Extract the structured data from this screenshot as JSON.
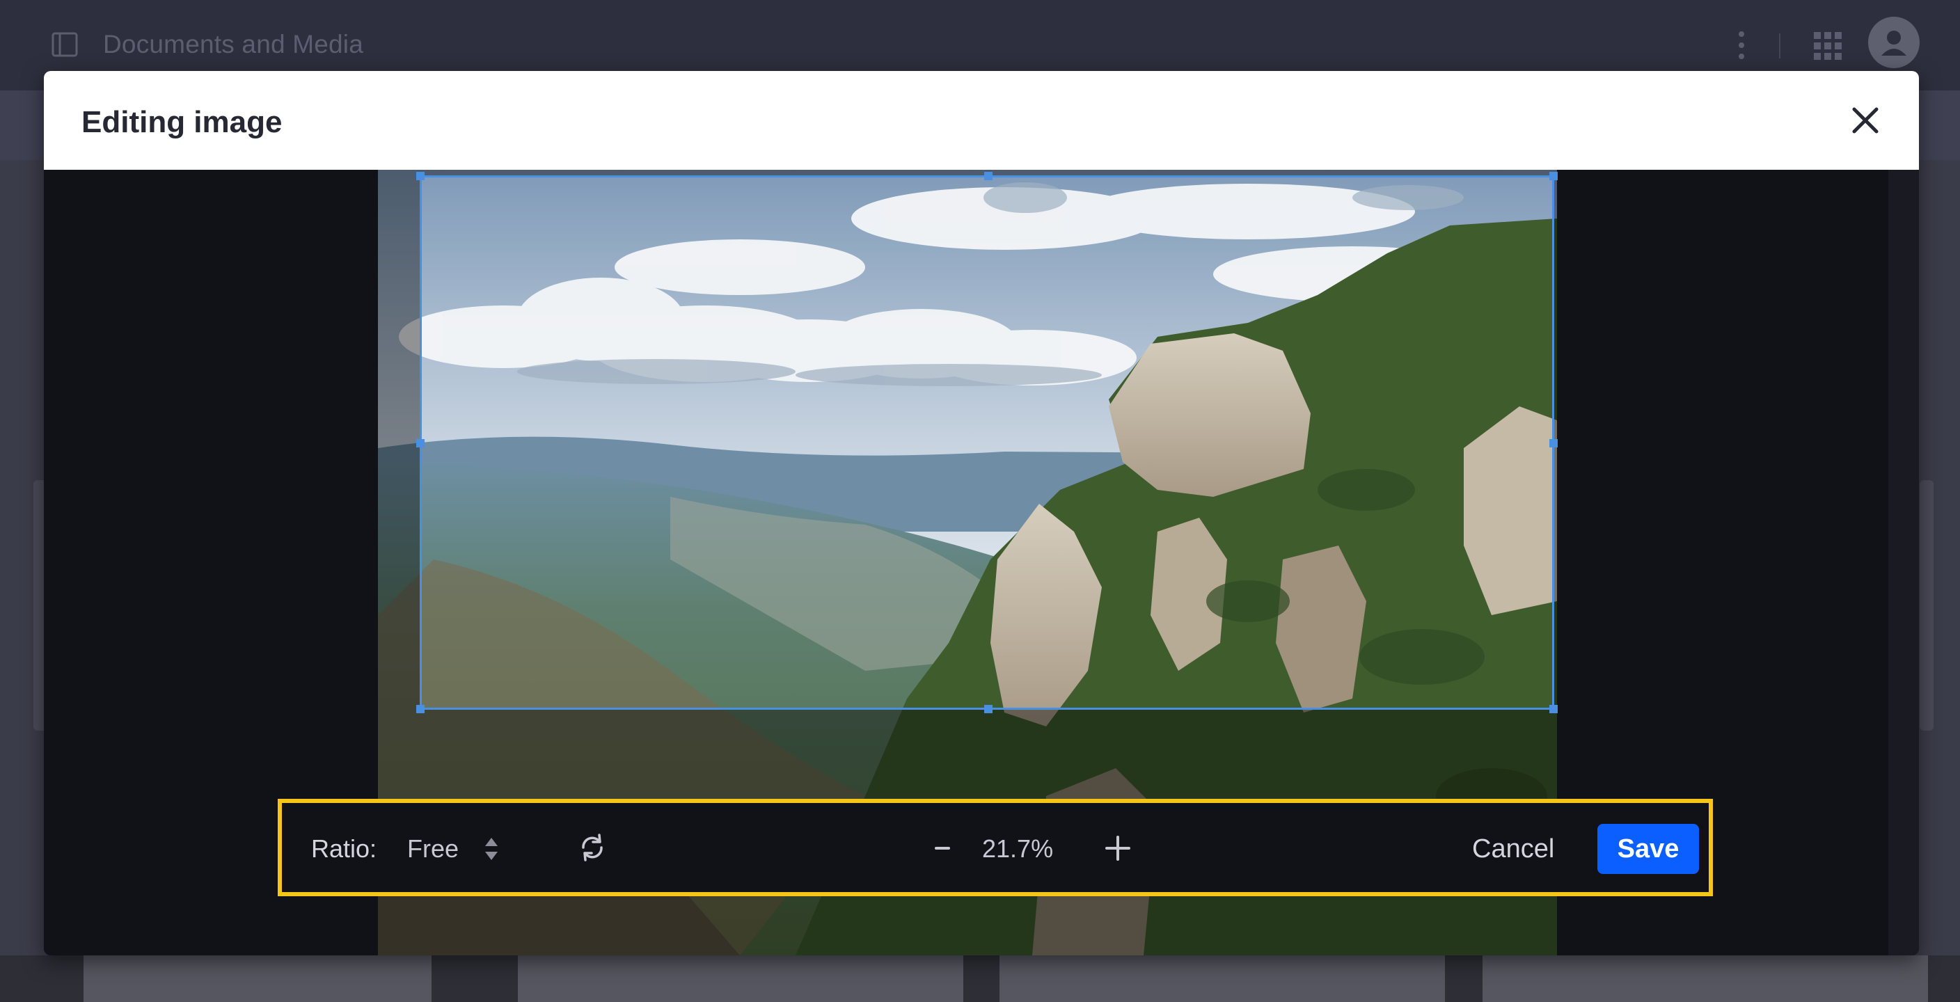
{
  "app": {
    "title": "Documents and Media",
    "icons": {
      "sidebar_toggle": "sidebar-toggle-icon",
      "more": "kebab-menu-icon",
      "apps": "apps-grid-icon",
      "user": "user-avatar-icon"
    }
  },
  "modal": {
    "title": "Editing image",
    "close_icon": "close-icon"
  },
  "toolbar": {
    "ratio_label": "Ratio:",
    "ratio_value": "Free",
    "zoom_value": "21.7%",
    "cancel_label": "Cancel",
    "save_label": "Save",
    "icons": {
      "ratio_caret": "sort-caret-icon",
      "rotate": "rotate-icon",
      "zoom_out": "minus-icon",
      "zoom_in": "plus-icon"
    }
  },
  "colors": {
    "accent": "#0b5fff",
    "crop_border": "#4a90e2",
    "highlight": "#f5c518",
    "editor_bg": "#111217"
  }
}
